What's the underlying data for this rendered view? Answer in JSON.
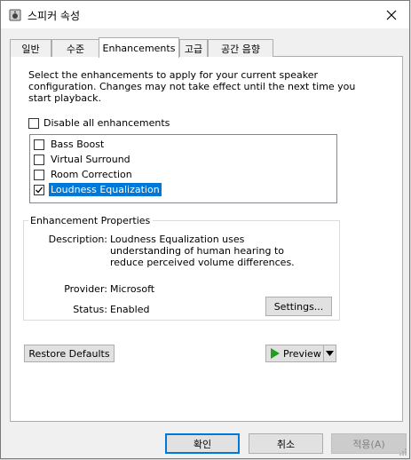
{
  "window": {
    "title": "스피커 속성",
    "colors": {
      "accent": "#0078d7",
      "play_green": "#1ea01e"
    }
  },
  "tabs": [
    {
      "label": "일반"
    },
    {
      "label": "수준"
    },
    {
      "label": "Enhancements",
      "active": true
    },
    {
      "label": "고급"
    },
    {
      "label": "공간 음향"
    }
  ],
  "enhancements_tab": {
    "description": "Select the enhancements to apply for your current speaker configuration. Changes may not take effect until the next time you start playback.",
    "disable_all": {
      "label": "Disable all enhancements",
      "checked": false
    },
    "items": [
      {
        "label": "Bass Boost",
        "checked": false
      },
      {
        "label": "Virtual Surround",
        "checked": false
      },
      {
        "label": "Room Correction",
        "checked": false
      },
      {
        "label": "Loudness Equalization",
        "checked": true,
        "selected": true
      }
    ],
    "properties": {
      "group_title": "Enhancement Properties",
      "description_label": "Description:",
      "description_value": "Loudness Equalization uses understanding of human hearing to reduce perceived volume differences.",
      "provider_label": "Provider:",
      "provider_value": "Microsoft",
      "status_label": "Status:",
      "status_value": "Enabled",
      "settings_button": "Settings..."
    },
    "restore_defaults": "Restore Defaults",
    "preview": "Preview"
  },
  "footer": {
    "ok": "확인",
    "cancel": "취소",
    "apply": "적용(A)"
  }
}
